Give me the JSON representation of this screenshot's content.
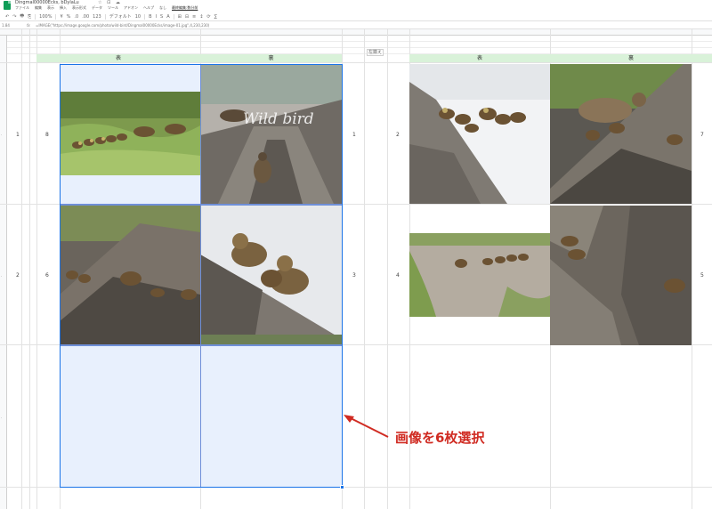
{
  "app": {
    "title": "Dingmal00000Ecks, bDylaLu",
    "title_icons": "☆ ⊡ ☁",
    "menu": [
      "ファイル",
      "編集",
      "表示",
      "挿入",
      "表示形式",
      "データ",
      "ツール",
      "アドオン",
      "ヘルプ",
      "なし",
      "最終編集:数分前"
    ]
  },
  "toolbar": {
    "buttons": [
      "↶",
      "↷",
      "🖶",
      "⎘",
      "100%",
      "¥",
      "%",
      ".0",
      ".00",
      "123",
      "デフォルト",
      "10",
      "B",
      "I",
      "S",
      "A",
      "⊞",
      "⊟",
      "≡",
      "↕",
      "⟳",
      "∑"
    ]
  },
  "formula_bar": {
    "cell_ref": "1.84",
    "fx": "fx",
    "text": "=IMAGE(\"https://image.google.com/photo/wild-bird/Dingmal00000Ecks/image-01.jpg\",4,230,230)"
  },
  "grid": {
    "bands": [
      {
        "id": "band-a",
        "label": "表"
      },
      {
        "id": "band-b",
        "label": "裏"
      },
      {
        "id": "band-c",
        "label": "表"
      },
      {
        "id": "band-d",
        "label": "裏"
      }
    ],
    "note_label": "左揃え",
    "row_labels": [
      "1",
      "2"
    ],
    "cell_numbers": {
      "n8": "8",
      "n1": "1",
      "n2": "2",
      "n7": "7",
      "n6": "6",
      "n3": "3",
      "n4": "4",
      "n5": "5"
    }
  },
  "photos": [
    {
      "id": "photo-ducklings-grass",
      "subject": "ducklings walking on grass"
    },
    {
      "id": "photo-wild-bird-ramp",
      "subject": "duck on concrete ramp",
      "watermark": "Wild bird"
    },
    {
      "id": "photo-ducklings-slope",
      "subject": "ducklings on concrete slope"
    },
    {
      "id": "photo-ducklings-closeup",
      "subject": "two ducklings close-up"
    },
    {
      "id": "photo-ducklings-water",
      "subject": "ducklings in water"
    },
    {
      "id": "photo-duck-family",
      "subject": "adult duck with ducklings"
    },
    {
      "id": "photo-ducklings-path",
      "subject": "ducklings on gravel path"
    },
    {
      "id": "photo-ducklings-corner",
      "subject": "ducklings near concrete corner"
    }
  ],
  "annotation": {
    "text": "画像を6枚選択"
  },
  "colors": {
    "selection_border": "#1a73e8",
    "selection_fill": "#e8f0fd",
    "band_green": "#d9f2d9",
    "annotation_red": "#d02b22"
  }
}
